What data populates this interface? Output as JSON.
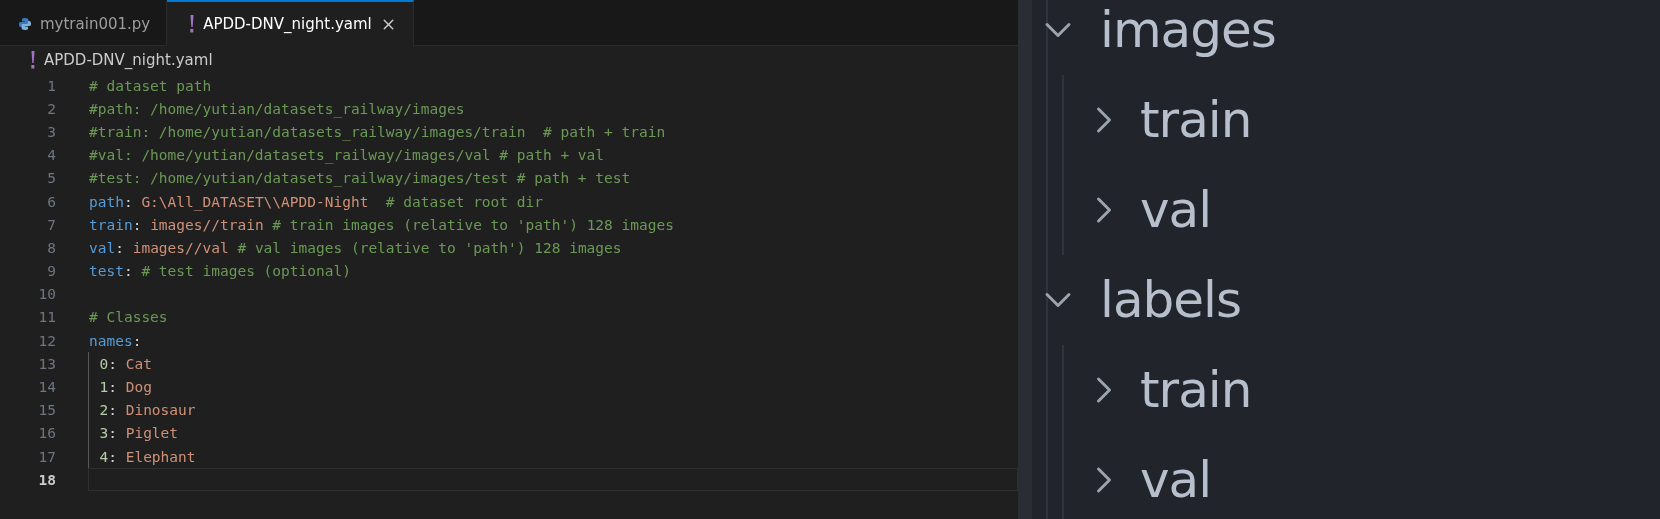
{
  "tabs": [
    {
      "label": "mytrain001.py",
      "kind": "python",
      "selected": false
    },
    {
      "label": "APDD-DNV_night.yaml",
      "kind": "yaml",
      "selected": true
    }
  ],
  "breadcrumb": {
    "kind": "yaml",
    "label": "APDD-DNV_night.yaml"
  },
  "lines": [
    {
      "number": "1",
      "current": false,
      "tokens": [
        {
          "kind": "comment",
          "text": "# dataset path"
        }
      ]
    },
    {
      "number": "2",
      "current": false,
      "tokens": [
        {
          "kind": "comment",
          "text": "#path: /home/yutian/datasets_railway/images"
        }
      ]
    },
    {
      "number": "3",
      "current": false,
      "tokens": [
        {
          "kind": "comment",
          "text": "#train: /home/yutian/datasets_railway/images/train  # path + train"
        }
      ]
    },
    {
      "number": "4",
      "current": false,
      "tokens": [
        {
          "kind": "comment",
          "text": "#val: /home/yutian/datasets_railway/images/val # path + val"
        }
      ]
    },
    {
      "number": "5",
      "current": false,
      "tokens": [
        {
          "kind": "comment",
          "text": "#test: /home/yutian/datasets_railway/images/test # path + test"
        }
      ]
    },
    {
      "number": "6",
      "current": false,
      "tokens": [
        {
          "kind": "key",
          "text": "path"
        },
        {
          "kind": "punct",
          "text": ": "
        },
        {
          "kind": "string",
          "text": "G:\\All_DATASET\\\\APDD-Night"
        },
        {
          "kind": "comment",
          "text": "  # dataset root dir"
        }
      ]
    },
    {
      "number": "7",
      "current": false,
      "tokens": [
        {
          "kind": "key",
          "text": "train"
        },
        {
          "kind": "punct",
          "text": ": "
        },
        {
          "kind": "string",
          "text": "images//train"
        },
        {
          "kind": "comment",
          "text": " # train images (relative to 'path') 128 images"
        }
      ]
    },
    {
      "number": "8",
      "current": false,
      "tokens": [
        {
          "kind": "key",
          "text": "val"
        },
        {
          "kind": "punct",
          "text": ": "
        },
        {
          "kind": "string",
          "text": "images//val"
        },
        {
          "kind": "comment",
          "text": " # val images (relative to 'path') 128 images"
        }
      ]
    },
    {
      "number": "9",
      "current": false,
      "tokens": [
        {
          "kind": "key",
          "text": "test"
        },
        {
          "kind": "punct",
          "text": ": "
        },
        {
          "kind": "comment",
          "text": "# test images (optional)"
        }
      ]
    },
    {
      "number": "10",
      "current": false
    },
    {
      "number": "11",
      "current": false,
      "tokens": [
        {
          "kind": "comment",
          "text": "# Classes"
        }
      ]
    },
    {
      "number": "12",
      "current": false,
      "tokens": [
        {
          "kind": "key",
          "text": "names"
        },
        {
          "kind": "punct",
          "text": ":"
        }
      ],
      "children": [
        {
          "number": "13",
          "current": false,
          "tokens": [
            {
              "kind": "number",
              "text": "0"
            },
            {
              "kind": "punct",
              "text": ": "
            },
            {
              "kind": "string",
              "text": "Cat"
            }
          ]
        },
        {
          "number": "14",
          "current": false,
          "tokens": [
            {
              "kind": "number",
              "text": "1"
            },
            {
              "kind": "punct",
              "text": ": "
            },
            {
              "kind": "string",
              "text": "Dog"
            }
          ]
        },
        {
          "number": "15",
          "current": false,
          "tokens": [
            {
              "kind": "number",
              "text": "2"
            },
            {
              "kind": "punct",
              "text": ": "
            },
            {
              "kind": "string",
              "text": "Dinosaur"
            }
          ]
        },
        {
          "number": "16",
          "current": false,
          "tokens": [
            {
              "kind": "number",
              "text": "3"
            },
            {
              "kind": "punct",
              "text": ": "
            },
            {
              "kind": "string",
              "text": "Piglet"
            }
          ]
        },
        {
          "number": "17",
          "current": false,
          "tokens": [
            {
              "kind": "number",
              "text": "4"
            },
            {
              "kind": "punct",
              "text": ": "
            },
            {
              "kind": "string",
              "text": "Elephant"
            }
          ]
        }
      ]
    },
    {
      "number": "18",
      "current": true
    }
  ],
  "explorer": [
    {
      "label": "images",
      "expanded": true,
      "children": [
        {
          "label": "train",
          "expanded": false
        },
        {
          "label": "val",
          "expanded": false
        }
      ]
    },
    {
      "label": "labels",
      "expanded": true,
      "children": [
        {
          "label": "train",
          "expanded": false
        },
        {
          "label": "val",
          "expanded": false
        }
      ]
    }
  ]
}
